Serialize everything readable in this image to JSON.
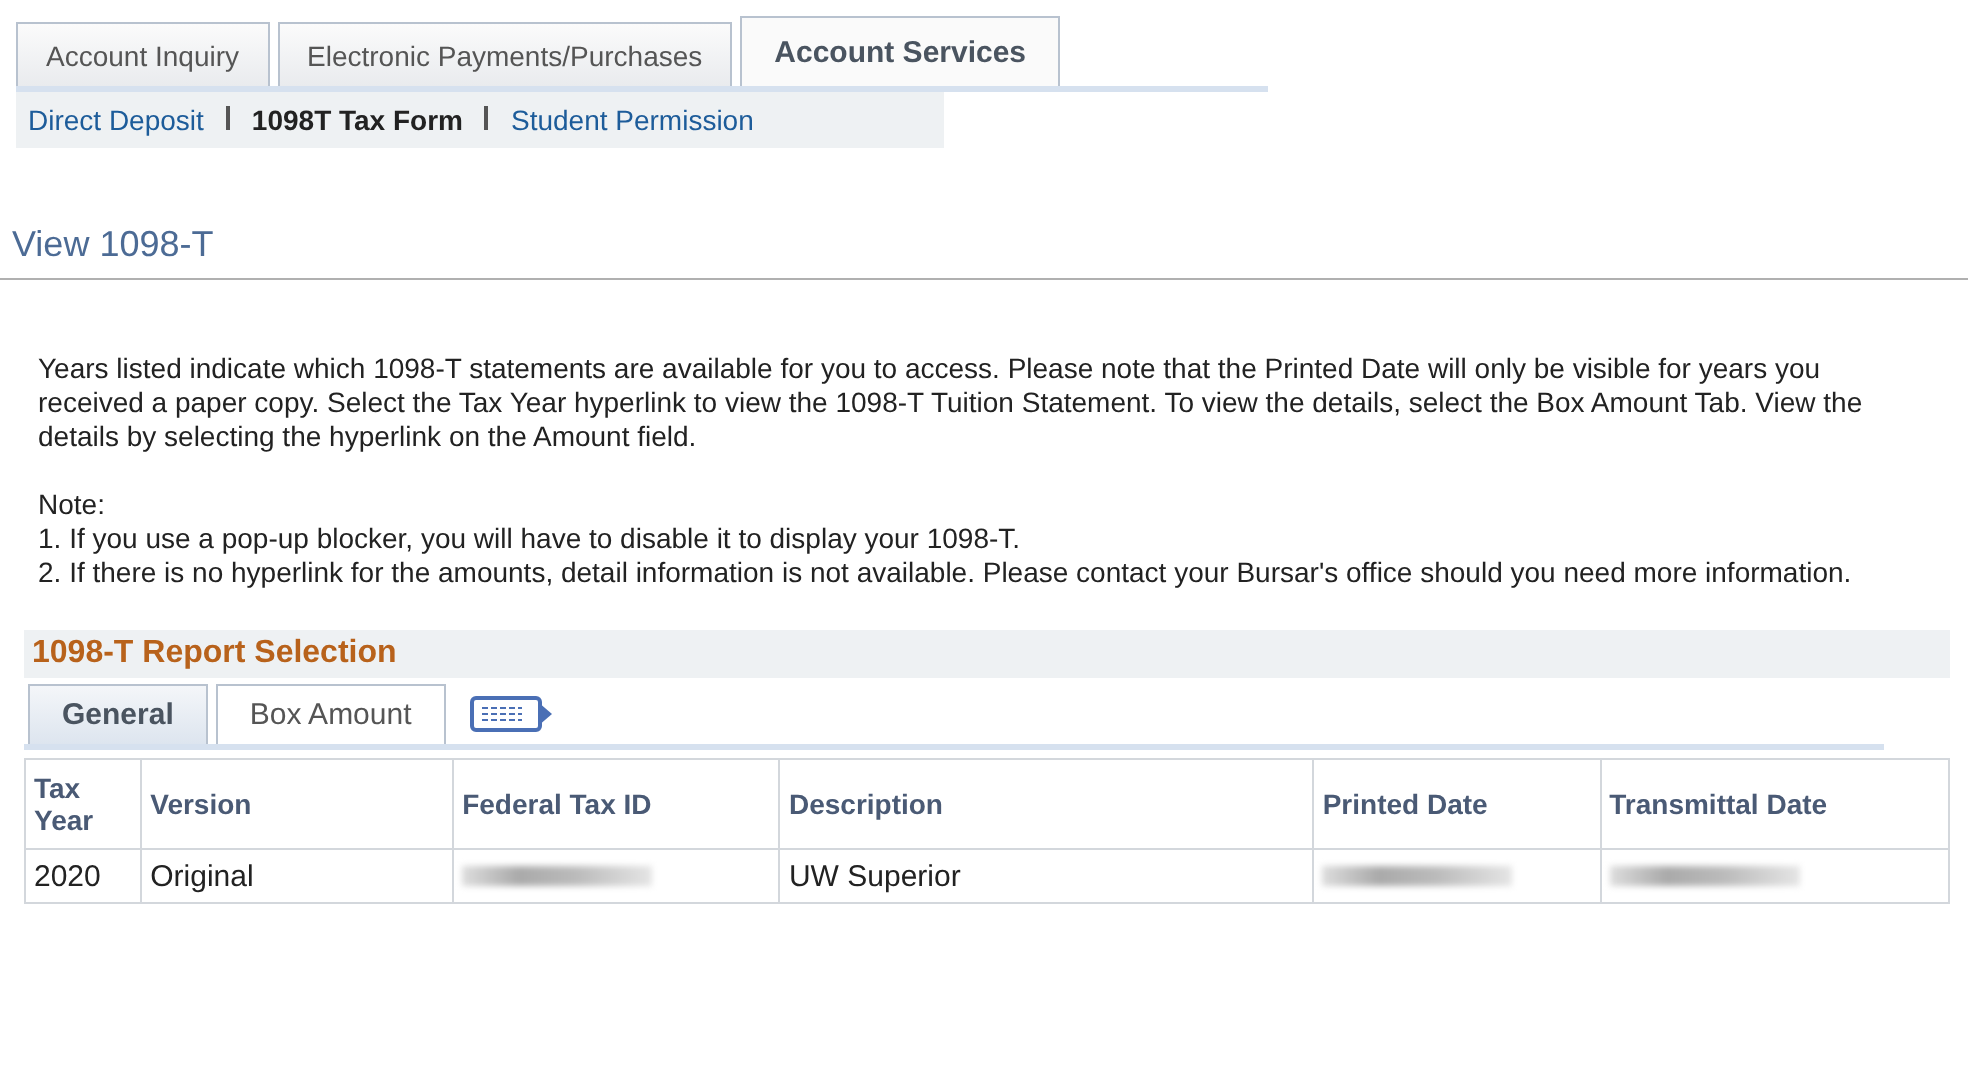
{
  "top_tabs": [
    {
      "label": "Account Inquiry",
      "selected": false
    },
    {
      "label": "Electronic Payments/Purchases",
      "selected": false
    },
    {
      "label": "Account Services",
      "selected": true
    }
  ],
  "sub_nav": [
    {
      "label": "Direct Deposit",
      "selected": false
    },
    {
      "label": "1098T Tax Form",
      "selected": true
    },
    {
      "label": "Student Permission",
      "selected": false
    }
  ],
  "page_title": "View 1098-T",
  "intro": "Years listed indicate which 1098-T statements are available for you to access.  Please note that the Printed Date will only be visible for years you received a paper copy.  Select the Tax Year hyperlink to view the 1098-T Tuition Statement.  To view the details, select the Box Amount Tab.  View the details by selecting the hyperlink on the Amount field.",
  "notes": [
    "Note:",
    "1.  If you use a pop-up blocker, you will have to disable it to display your 1098-T.",
    "2.  If there is no hyperlink for the amounts, detail information is not available.  Please contact your Bursar's office should you need more information."
  ],
  "section_title": "1098-T Report Selection",
  "grid_tabs": [
    {
      "label": "General",
      "selected": true
    },
    {
      "label": "Box Amount",
      "selected": false
    }
  ],
  "table": {
    "columns": [
      "Tax Year",
      "Version",
      "Federal Tax ID",
      "Description",
      "Printed Date",
      "Transmittal Date"
    ],
    "rows": [
      [
        {
          "kind": "text",
          "text": "2020"
        },
        {
          "kind": "text",
          "text": "Original"
        },
        {
          "kind": "blurred"
        },
        {
          "kind": "text",
          "text": "UW Superior"
        },
        {
          "kind": "blurred"
        },
        {
          "kind": "blurred"
        }
      ]
    ]
  }
}
